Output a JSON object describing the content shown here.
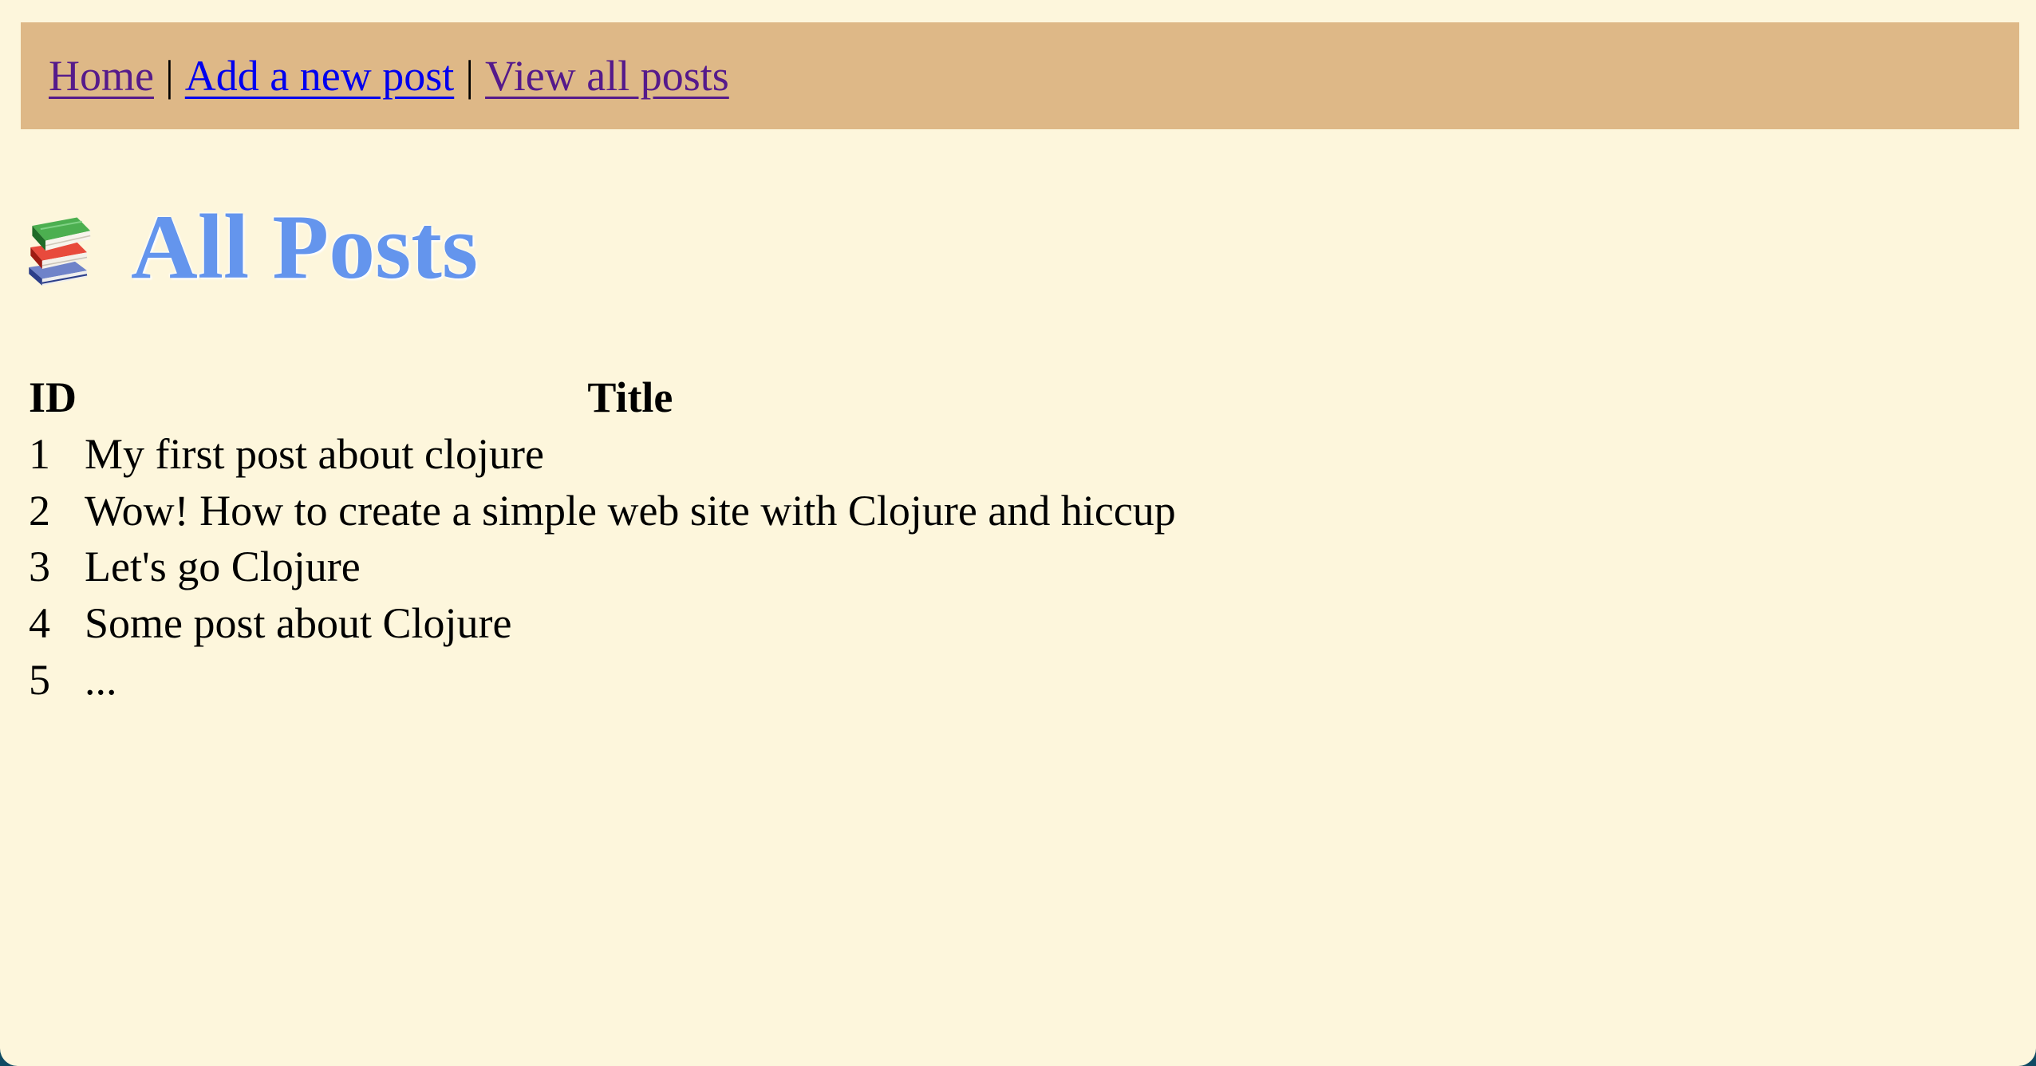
{
  "nav": {
    "home_label": "Home",
    "add_label": "Add a new post",
    "view_all_label": "View all posts",
    "separator": "|",
    "background_color": "#deb887",
    "visited_link_color": "#551a8b",
    "link_color": "#0000ee"
  },
  "page": {
    "icon": "books-icon",
    "title": "All Posts",
    "title_color": "#6495ed",
    "background_color": "#fdf6dc"
  },
  "table": {
    "headers": {
      "id": "ID",
      "title": "Title"
    },
    "rows": [
      {
        "id": "1",
        "title": "My first post about clojure"
      },
      {
        "id": "2",
        "title": "Wow! How to create a simple web site with Clojure and hiccup"
      },
      {
        "id": "3",
        "title": "Let's go Clojure"
      },
      {
        "id": "4",
        "title": "Some post about Clojure"
      },
      {
        "id": "5",
        "title": "..."
      }
    ]
  }
}
